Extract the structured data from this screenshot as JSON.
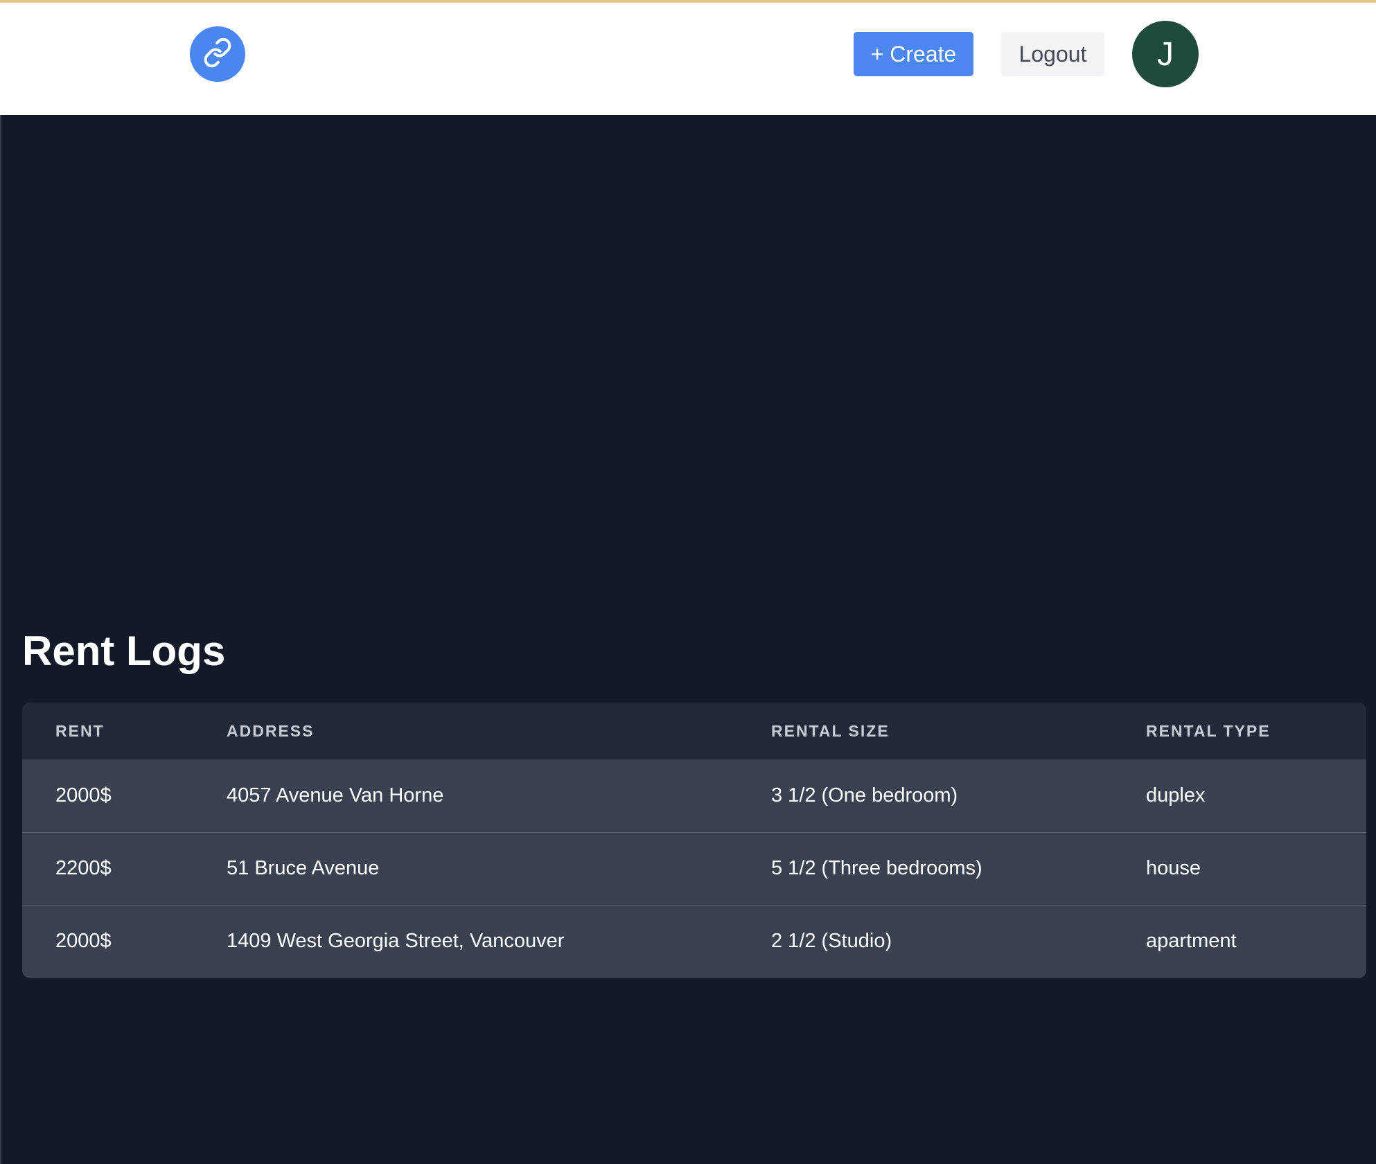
{
  "header": {
    "logo_icon": "link-icon",
    "create_label": "+ Create",
    "logout_label": "Logout",
    "avatar_initial": "J"
  },
  "colors": {
    "accent": "#4c86ee",
    "avatar": "#1e4b3b",
    "page_background": "#131927",
    "table_header": "#222938",
    "table_row": "#3a4150"
  },
  "main": {
    "title": "Rent Logs",
    "table": {
      "columns": [
        "RENT",
        "ADDRESS",
        "RENTAL SIZE",
        "RENTAL TYPE"
      ],
      "rows": [
        [
          "2000$",
          "4057 Avenue Van Horne",
          "3 1/2 (One bedroom)",
          "duplex"
        ],
        [
          "2200$",
          "51 Bruce Avenue",
          "5 1/2 (Three bedrooms)",
          "house"
        ],
        [
          "2000$",
          "1409 West Georgia Street, Vancouver",
          "2 1/2 (Studio)",
          "apartment"
        ]
      ]
    }
  }
}
